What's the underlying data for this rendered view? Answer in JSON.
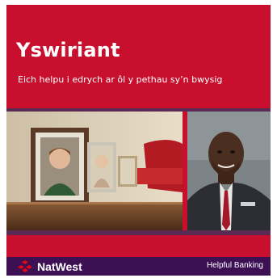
{
  "leaflet": {
    "title": "Yswiriant",
    "subtitle": "Eich helpu i edrych ar ôl y pethau sy’n bwysig"
  },
  "photos": {
    "left": "photo-frames-on-sideboard",
    "right": "smiling-man-in-suit"
  },
  "footer": {
    "brand": "NatWest",
    "tagline": "Helpful Banking",
    "logo_icon": "natwest-cubes-logo"
  },
  "colors": {
    "brand_red": "#c8102e",
    "purple": "#3c1053",
    "accent_purple": "#5a2a52"
  }
}
